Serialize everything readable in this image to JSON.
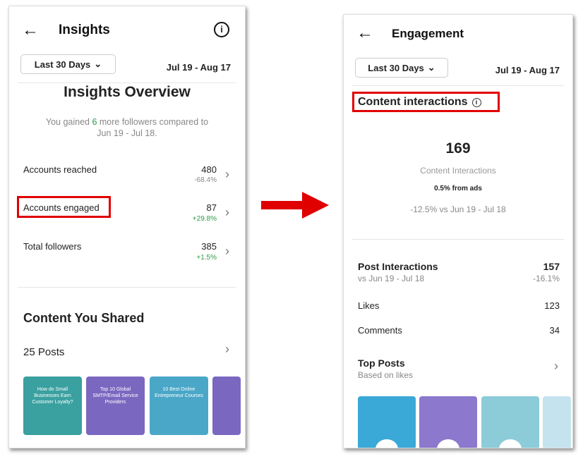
{
  "left": {
    "title": "Insights",
    "date_filter": "Last 30 Days",
    "date_range": "Jul 19 - Aug 17",
    "overview_title": "Insights Overview",
    "gained_prefix": "You gained ",
    "gained_count": "6",
    "gained_suffix": " more followers compared to",
    "gained_range": "Jun 19 - Jul 18.",
    "metrics": [
      {
        "label": "Accounts reached",
        "value": "480",
        "change": "-68.4%"
      },
      {
        "label": "Accounts engaged",
        "value": "87",
        "change": "+29.8%"
      },
      {
        "label": "Total followers",
        "value": "385",
        "change": "+1.5%"
      }
    ],
    "content_title": "Content You Shared",
    "posts_count": "25 Posts",
    "thumbnails": [
      {
        "title": "How do Small Businesses Earn Customer Loyalty?",
        "color": "#3aa0a0"
      },
      {
        "title": "Top 10 Global SMTP/Email Service Providers",
        "color": "#7a68c0"
      },
      {
        "title": "10 Best Online Entrepreneur Courses",
        "color": "#4aa7c8"
      },
      {
        "title": "",
        "color": "#7a68c0"
      }
    ]
  },
  "right": {
    "title": "Engagement",
    "date_filter": "Last 30 Days",
    "date_range": "Jul 19 - Aug 17",
    "section_title": "Content interactions",
    "total": "169",
    "total_label": "Content Interactions",
    "ads": "0.5% from ads",
    "comparison": "-12.5% vs Jun 19 - Jul 18",
    "post_interactions": {
      "label": "Post Interactions",
      "value": "157",
      "sub": "vs Jun 19 - Jul 18",
      "change": "-16.1%"
    },
    "likes": {
      "label": "Likes",
      "value": "123"
    },
    "comments": {
      "label": "Comments",
      "value": "34"
    },
    "top_posts": {
      "label": "Top Posts",
      "sub": "Based on likes"
    },
    "thumbnails": [
      {
        "color": "#3aa9d8"
      },
      {
        "color": "#8c78cc"
      },
      {
        "color": "#8ccbd8"
      },
      {
        "color": "#c5e3ee"
      }
    ]
  },
  "colors": {
    "highlight": "#e00000",
    "positive": "#2e9a4a"
  }
}
